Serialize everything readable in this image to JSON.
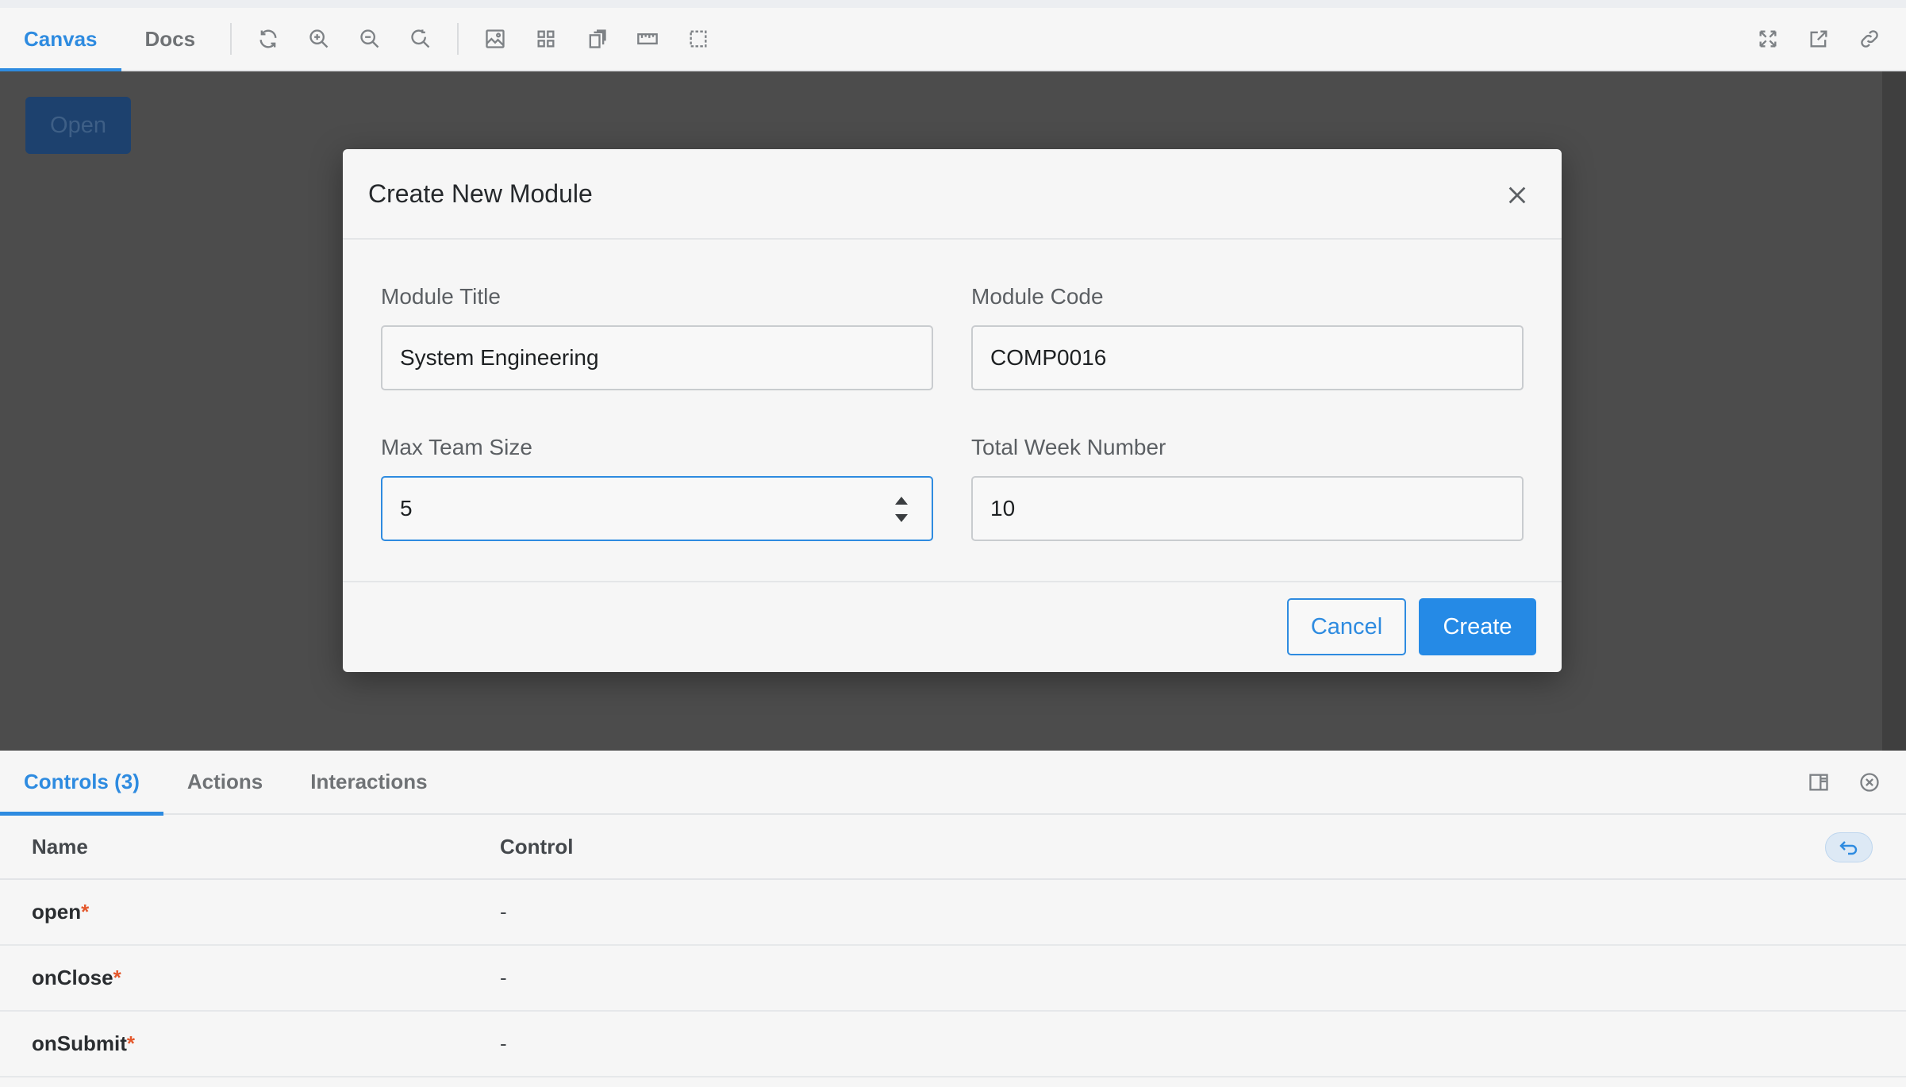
{
  "toolbar": {
    "tabs": [
      {
        "label": "Canvas",
        "active": true
      },
      {
        "label": "Docs",
        "active": false
      }
    ],
    "icons": [
      "reload-icon",
      "zoom-in-icon",
      "zoom-out-icon",
      "zoom-reset-icon",
      "background-icon",
      "grid-icon",
      "viewport-icon",
      "measure-icon",
      "outline-icon"
    ],
    "right_icons": [
      "fullscreen-icon",
      "open-new-tab-icon",
      "copy-link-icon"
    ]
  },
  "canvas": {
    "open_button": "Open"
  },
  "modal": {
    "title": "Create New Module",
    "fields": {
      "module_title": {
        "label": "Module Title",
        "value": "System Engineering"
      },
      "module_code": {
        "label": "Module Code",
        "value": "COMP0016"
      },
      "max_team_size": {
        "label": "Max Team Size",
        "value": "5"
      },
      "total_week_number": {
        "label": "Total Week Number",
        "value": "10"
      }
    },
    "cancel_label": "Cancel",
    "create_label": "Create"
  },
  "panel": {
    "tabs": [
      {
        "label": "Controls (3)",
        "active": true
      },
      {
        "label": "Actions",
        "active": false
      },
      {
        "label": "Interactions",
        "active": false
      }
    ],
    "columns": {
      "name": "Name",
      "control": "Control"
    },
    "rows": [
      {
        "name": "open",
        "required": "*",
        "control": "-"
      },
      {
        "name": "onClose",
        "required": "*",
        "control": "-"
      },
      {
        "name": "onSubmit",
        "required": "*",
        "control": "-"
      }
    ]
  },
  "colors": {
    "accent": "#2e8be0",
    "overlay": "#4c4c4c",
    "required": "#e4582c"
  }
}
